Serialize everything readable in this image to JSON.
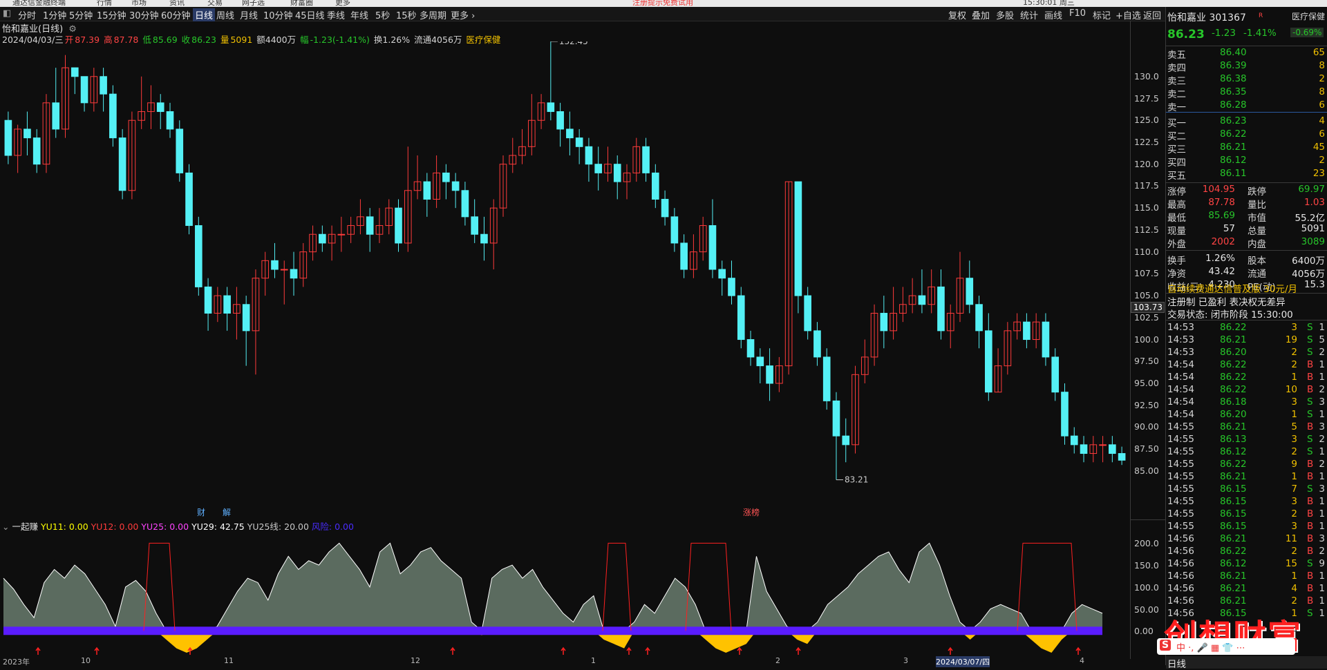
{
  "topbar": {
    "items": [
      "通达信金融终端",
      "行情",
      "市场",
      "资讯",
      "交易",
      "网子选",
      "财富圈",
      "更多"
    ],
    "alert": "注册提示免费试用",
    "time": "15:30:01 周三"
  },
  "periods": [
    "分时",
    "1分钟",
    "5分钟",
    "15分钟",
    "30分钟",
    "60分钟",
    "日线",
    "周线",
    "月线",
    "10分钟",
    "45日线",
    "季线",
    "年线",
    "5秒",
    "15秒",
    "多周期",
    "更多 ›"
  ],
  "active_period": "日线",
  "toolbar_right": [
    "复权",
    "叠加",
    "多股",
    "统计",
    "画线",
    "F10",
    "标记",
    "+自选",
    "返回"
  ],
  "chart": {
    "title": "怡和嘉业(日线)",
    "info": {
      "date": "2024/04/03/三",
      "open_label": "开",
      "open": "87.39",
      "high_label": "高",
      "high": "87.78",
      "low_label": "低",
      "low": "85.69",
      "close_label": "收",
      "close": "86.23",
      "vol_label": "量",
      "vol": "5091",
      "amount": "额4400万",
      "change_label": "幅",
      "change": "-1.23(-1.41%)",
      "turnover": "换1.26%",
      "float": "流通4056万",
      "industry": "医疗保健"
    },
    "price_axis": [
      "130.0",
      "127.5",
      "125.0",
      "122.5",
      "120.0",
      "117.5",
      "115.0",
      "112.5",
      "110.0",
      "107.5",
      "105.0",
      "102.5",
      "100.0",
      "97.50",
      "95.00",
      "92.50",
      "90.00",
      "87.50",
      "85.00"
    ],
    "current_price_tag": "103.73",
    "high_marker": "132.45",
    "low_marker": "83.21",
    "event_labels": [
      "财",
      "解",
      "涨榜"
    ],
    "colors": {
      "up": "#ff3b3b",
      "down": "#54f0f5",
      "bg": "#0e0e0e"
    }
  },
  "chart_data": {
    "type": "candlestick",
    "ylim": [
      83.21,
      132.45
    ],
    "candles": [
      [
        125,
        121,
        126,
        120
      ],
      [
        121,
        124,
        124.5,
        119
      ],
      [
        124,
        123,
        126,
        121
      ],
      [
        123,
        120,
        124,
        119
      ],
      [
        120,
        127,
        128,
        119
      ],
      [
        127,
        124,
        131,
        123
      ],
      [
        124,
        131,
        132.45,
        123
      ],
      [
        131,
        130,
        131,
        128
      ],
      [
        130,
        127,
        130,
        126
      ],
      [
        127,
        130,
        131,
        126
      ],
      [
        130,
        128,
        131,
        126
      ],
      [
        128,
        123,
        129,
        122
      ],
      [
        123,
        117,
        124,
        116
      ],
      [
        117,
        125,
        126,
        116
      ],
      [
        125,
        126,
        130,
        124
      ],
      [
        126,
        127,
        129,
        124
      ],
      [
        127,
        126,
        128,
        124
      ],
      [
        126,
        124,
        127,
        123
      ],
      [
        124,
        119,
        125,
        118
      ],
      [
        119,
        113,
        120,
        112
      ],
      [
        113,
        106,
        114,
        105
      ],
      [
        106,
        103,
        107,
        101
      ],
      [
        103,
        105,
        106,
        102
      ],
      [
        105,
        103,
        106,
        101
      ],
      [
        103,
        104,
        106,
        100
      ],
      [
        104,
        101,
        105,
        97
      ],
      [
        101,
        107,
        108,
        96
      ],
      [
        107,
        109,
        110,
        105
      ],
      [
        109,
        108,
        111,
        107
      ],
      [
        108,
        108,
        109,
        104
      ],
      [
        108,
        107,
        110,
        105
      ],
      [
        107,
        110,
        111,
        106
      ],
      [
        110,
        112,
        113,
        109
      ],
      [
        112,
        111,
        113,
        110
      ],
      [
        111,
        112,
        113,
        109
      ],
      [
        112,
        112,
        114,
        110
      ],
      [
        112,
        113,
        114,
        111
      ],
      [
        113,
        114,
        116,
        112
      ],
      [
        114,
        112,
        115,
        110
      ],
      [
        112,
        113,
        115,
        111
      ],
      [
        113,
        115,
        116,
        112
      ],
      [
        115,
        111,
        116,
        110
      ],
      [
        111,
        117,
        122,
        110
      ],
      [
        117,
        118,
        121,
        116
      ],
      [
        118,
        116,
        119,
        114
      ],
      [
        116,
        119,
        121,
        115
      ],
      [
        119,
        118,
        120,
        116
      ],
      [
        118,
        117,
        119,
        115
      ],
      [
        117,
        114,
        118,
        113
      ],
      [
        114,
        112,
        116,
        111
      ],
      [
        112,
        111,
        114,
        109
      ],
      [
        111,
        115,
        116,
        108
      ],
      [
        115,
        120,
        121,
        114
      ],
      [
        120,
        121,
        123,
        119
      ],
      [
        121,
        122,
        124,
        120
      ],
      [
        122,
        125,
        128,
        121
      ],
      [
        125,
        127,
        128,
        124
      ],
      [
        127,
        126,
        134,
        125
      ],
      [
        126,
        124,
        127,
        122
      ],
      [
        124,
        123,
        126,
        121
      ],
      [
        123,
        122,
        124,
        120
      ],
      [
        122,
        120,
        123,
        118
      ],
      [
        120,
        119,
        122,
        117
      ],
      [
        119,
        120,
        122,
        118
      ],
      [
        120,
        118,
        121,
        116
      ],
      [
        118,
        119,
        120,
        116
      ],
      [
        119,
        122,
        123,
        118
      ],
      [
        122,
        119,
        123,
        118
      ],
      [
        119,
        116,
        120,
        115
      ],
      [
        116,
        114,
        117,
        113
      ],
      [
        114,
        111,
        115,
        110
      ],
      [
        111,
        108,
        112,
        107
      ],
      [
        108,
        110,
        112,
        107
      ],
      [
        110,
        113,
        114,
        109
      ],
      [
        113,
        108,
        116,
        107
      ],
      [
        108,
        107,
        109,
        105
      ],
      [
        107,
        105,
        109,
        104
      ],
      [
        105,
        100,
        106,
        99
      ],
      [
        100,
        98,
        101,
        97
      ],
      [
        98,
        97,
        99,
        95
      ],
      [
        97,
        95,
        99,
        93
      ],
      [
        95,
        97,
        98,
        94
      ],
      [
        97,
        118,
        118,
        96
      ],
      [
        118,
        105,
        118,
        103
      ],
      [
        105,
        101,
        106,
        100
      ],
      [
        101,
        98,
        102,
        97
      ],
      [
        98,
        93,
        99,
        92
      ],
      [
        93,
        89,
        94,
        84
      ],
      [
        89,
        88,
        91,
        86
      ],
      [
        88,
        96,
        97,
        87
      ],
      [
        96,
        98,
        100,
        95
      ],
      [
        98,
        103,
        104,
        97
      ],
      [
        103,
        101,
        105,
        99
      ],
      [
        101,
        103,
        106,
        100
      ],
      [
        103,
        104,
        106,
        102
      ],
      [
        104,
        105,
        107,
        103
      ],
      [
        105,
        104,
        108,
        103
      ],
      [
        104,
        106,
        108,
        103
      ],
      [
        106,
        101,
        108,
        100
      ],
      [
        101,
        103,
        104,
        99
      ],
      [
        103,
        107,
        110,
        102
      ],
      [
        107,
        104,
        109,
        103
      ],
      [
        104,
        101,
        105,
        99
      ],
      [
        101,
        94,
        103,
        93
      ],
      [
        94,
        97,
        99,
        94
      ],
      [
        97,
        101,
        102,
        96
      ],
      [
        101,
        102,
        103,
        100
      ],
      [
        102,
        100,
        103,
        99
      ],
      [
        100,
        102,
        103,
        99
      ],
      [
        102,
        98,
        103,
        97
      ],
      [
        98,
        94,
        99,
        93
      ],
      [
        94,
        89,
        95,
        88
      ],
      [
        89,
        88,
        90,
        87
      ],
      [
        88,
        87,
        89,
        86
      ],
      [
        87,
        88,
        89,
        86
      ],
      [
        88,
        88,
        89,
        86
      ],
      [
        88,
        87,
        89,
        86
      ],
      [
        87,
        86.23,
        87.78,
        85.69
      ]
    ]
  },
  "indicator": {
    "name": "一起赚",
    "legend": [
      {
        "label": "YU11: 0.00",
        "color": "#ffff00"
      },
      {
        "label": "YU12: 0.00",
        "color": "#ff3b3b"
      },
      {
        "label": "YU25: 0.00",
        "color": "#ff44ff"
      },
      {
        "label": "YU29: 42.75",
        "color": "#ffffff"
      },
      {
        "label": "YU25线: 20.00",
        "color": "#c8c8c8"
      },
      {
        "label": "风险: 0.00",
        "color": "#4a2cff"
      }
    ],
    "axis": [
      "200.0",
      "150.0",
      "100.0",
      "50.00",
      "0.00"
    ]
  },
  "indicator_data": {
    "type": "area",
    "ylim": [
      -50,
      210
    ],
    "values": [
      120,
      95,
      60,
      30,
      110,
      140,
      120,
      150,
      130,
      95,
      60,
      10,
      100,
      115,
      90,
      40,
      -20,
      -40,
      -50,
      -40,
      -20,
      10,
      50,
      90,
      120,
      110,
      70,
      130,
      170,
      140,
      160,
      150,
      180,
      200,
      170,
      140,
      100,
      180,
      200,
      130,
      150,
      180,
      190,
      160,
      140,
      120,
      20,
      -10,
      120,
      140,
      150,
      120,
      140,
      100,
      70,
      40,
      20,
      60,
      80,
      -20,
      -30,
      -40,
      20,
      60,
      40,
      80,
      120,
      100,
      60,
      -20,
      -40,
      -50,
      -40,
      -30,
      170,
      90,
      50,
      10,
      -20,
      -30,
      20,
      60,
      80,
      100,
      130,
      150,
      170,
      180,
      140,
      110,
      180,
      200,
      150,
      80,
      20,
      -20,
      20,
      50,
      60,
      50,
      40,
      -20,
      -40,
      -50,
      -20,
      40,
      60,
      50,
      40
    ]
  },
  "bottom_axis": [
    "2023年",
    "10",
    "11",
    "12",
    "1",
    "2",
    "3",
    "2024/03/07/四",
    "4"
  ],
  "sidebar": {
    "stock_name": "怡和嘉业 301367",
    "rank_tag": "R",
    "industry": "医疗保健",
    "price": "86.23",
    "change": "-1.23",
    "change_pct": "-1.41%",
    "industry_pct": "-0.69%",
    "asks": [
      {
        "label": "卖五",
        "price": "86.40",
        "vol": "65"
      },
      {
        "label": "卖四",
        "price": "86.39",
        "vol": "8"
      },
      {
        "label": "卖三",
        "price": "86.38",
        "vol": "2"
      },
      {
        "label": "卖二",
        "price": "86.35",
        "vol": "8"
      },
      {
        "label": "卖一",
        "price": "86.28",
        "vol": "6"
      }
    ],
    "bids": [
      {
        "label": "买一",
        "price": "86.23",
        "vol": "4"
      },
      {
        "label": "买二",
        "price": "86.22",
        "vol": "6"
      },
      {
        "label": "买三",
        "price": "86.21",
        "vol": "45"
      },
      {
        "label": "买四",
        "price": "86.12",
        "vol": "2"
      },
      {
        "label": "买五",
        "price": "86.11",
        "vol": "23"
      }
    ],
    "stats": [
      {
        "l1": "涨停",
        "v1": "104.95",
        "c1": "red",
        "l2": "跌停",
        "v2": "69.97",
        "c2": "green"
      },
      {
        "l1": "最高",
        "v1": "87.78",
        "c1": "red",
        "l2": "量比",
        "v2": "1.03",
        "c2": "red"
      },
      {
        "l1": "最低",
        "v1": "85.69",
        "c1": "green",
        "l2": "市值",
        "v2": "55.2亿",
        "c2": "white"
      },
      {
        "l1": "现量",
        "v1": "57",
        "c1": "white",
        "l2": "总量",
        "v2": "5091",
        "c2": "white"
      },
      {
        "l1": "外盘",
        "v1": "2002",
        "c1": "red",
        "l2": "内盘",
        "v2": "3089",
        "c2": "green"
      }
    ],
    "stats2": [
      {
        "l1": "换手",
        "v1": "1.26%",
        "l2": "股本",
        "v2": "6400万"
      },
      {
        "l1": "净资",
        "v1": "43.42",
        "l2": "流通",
        "v2": "4056万"
      },
      {
        "l1": "收益(三)",
        "v1": "4.230",
        "l2": "PE(动)",
        "v2": "15.3"
      }
    ],
    "promo": "自动续费通达信普及版  30元/月",
    "reg": "注册制 已盈利 表决权无差异",
    "trade_status": "交易状态: 闭市阶段 15:30:00",
    "ticks": [
      [
        "14:53",
        "86.22",
        "3",
        "S",
        "1"
      ],
      [
        "14:53",
        "86.21",
        "19",
        "S",
        "5"
      ],
      [
        "14:53",
        "86.20",
        "2",
        "S",
        "2"
      ],
      [
        "14:54",
        "86.22",
        "2",
        "B",
        "1"
      ],
      [
        "14:54",
        "86.22",
        "1",
        "B",
        "1"
      ],
      [
        "14:54",
        "86.22",
        "10",
        "B",
        "2"
      ],
      [
        "14:54",
        "86.18",
        "3",
        "S",
        "3"
      ],
      [
        "14:54",
        "86.20",
        "1",
        "S",
        "1"
      ],
      [
        "14:55",
        "86.21",
        "5",
        "B",
        "3"
      ],
      [
        "14:55",
        "86.13",
        "3",
        "S",
        "2"
      ],
      [
        "14:55",
        "86.12",
        "2",
        "S",
        "1"
      ],
      [
        "14:55",
        "86.22",
        "9",
        "B",
        "2"
      ],
      [
        "14:55",
        "86.21",
        "1",
        "B",
        "1"
      ],
      [
        "14:55",
        "86.15",
        "7",
        "S",
        "3"
      ],
      [
        "14:55",
        "86.15",
        "3",
        "B",
        "1"
      ],
      [
        "14:55",
        "86.15",
        "2",
        "B",
        "1"
      ],
      [
        "14:55",
        "86.15",
        "3",
        "B",
        "1"
      ],
      [
        "14:56",
        "86.21",
        "11",
        "B",
        "3"
      ],
      [
        "14:56",
        "86.22",
        "2",
        "B",
        "2"
      ],
      [
        "14:56",
        "86.12",
        "15",
        "S",
        "9"
      ],
      [
        "14:56",
        "86.21",
        "1",
        "B",
        "1"
      ],
      [
        "14:56",
        "86.21",
        "4",
        "B",
        "1"
      ],
      [
        "14:56",
        "86.21",
        "2",
        "B",
        "1"
      ],
      [
        "14:56",
        "86.15",
        "1",
        "S",
        "1"
      ]
    ],
    "bottom_tab": "日线"
  },
  "watermark": "创想财富",
  "ime": "中 ·, 🎤 ▦ 👕 ⋯"
}
